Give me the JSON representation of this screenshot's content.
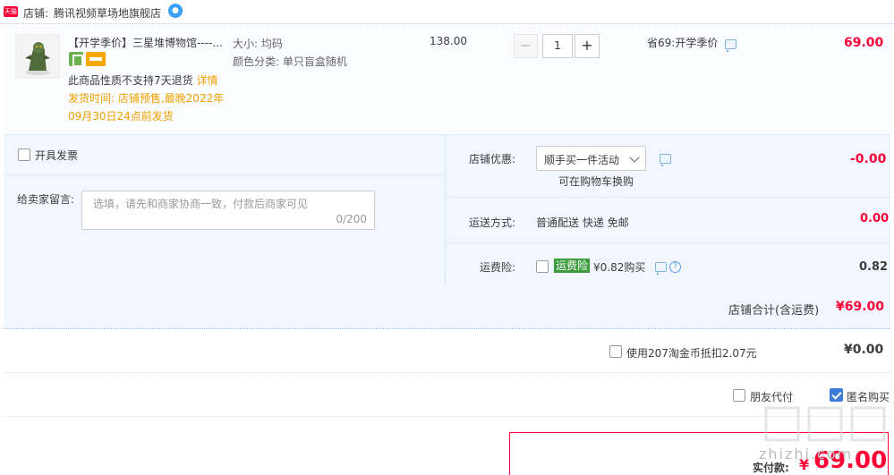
{
  "shop": {
    "badge": "天猫",
    "prefix": "店铺:",
    "name": "腾讯视频草场地旗舰店",
    "ww_icon": "ww-chat-icon"
  },
  "item": {
    "title": "【开学季价】三星堆博物馆----...",
    "sku_size": "大小:  均码",
    "sku_color": "颜色分类:  单只盲盒随机",
    "no_return": "此商品性质不支持7天退货",
    "detail_link": "详情",
    "ship_time": "发货时间:  店铺预售,最晚2022年09月30日24点前发货",
    "price": "138.00",
    "quantity": "1",
    "minus": "−",
    "plus": "+",
    "promo": "省69:开学季价",
    "total": "69.00"
  },
  "options": {
    "invoice_label": "开具发票",
    "message_label": "给卖家留言:",
    "message_placeholder": "选填，请先和商家协商一致，付款后商家可见",
    "message_count": "0/200",
    "shop_discount_label": "店铺优惠:",
    "shop_discount_value": "顺手买一件活动",
    "shop_discount_note": "可在购物车换购",
    "shop_discount_amount": "-0.00",
    "delivery_label": "运送方式:",
    "delivery_value": "普通配送 快递 免邮",
    "delivery_amount": "0.00",
    "insurance_label": "运费险:",
    "insurance_tag": "运费险",
    "insurance_price": "¥0.82购买",
    "insurance_amount": "0.82"
  },
  "shop_total": {
    "label": "店铺合计(含运费)",
    "value": "¥69.00"
  },
  "coins": {
    "label": "使用207淘金币抵扣2.07元",
    "value": "¥0.00"
  },
  "pay_options": {
    "friend_label": "朋友代付",
    "anonymous_label": "匿名购买",
    "anonymous_checked": true
  },
  "actual": {
    "label": "实付款:",
    "currency": "¥",
    "value": "69.00"
  },
  "watermark": {
    "text": "zhizhi.com"
  },
  "colors": {
    "accent_red": "#ff0036",
    "panel_blue": "#f2f7ff",
    "link_orange": "#f0a000",
    "check_blue": "#3e7bd6"
  }
}
